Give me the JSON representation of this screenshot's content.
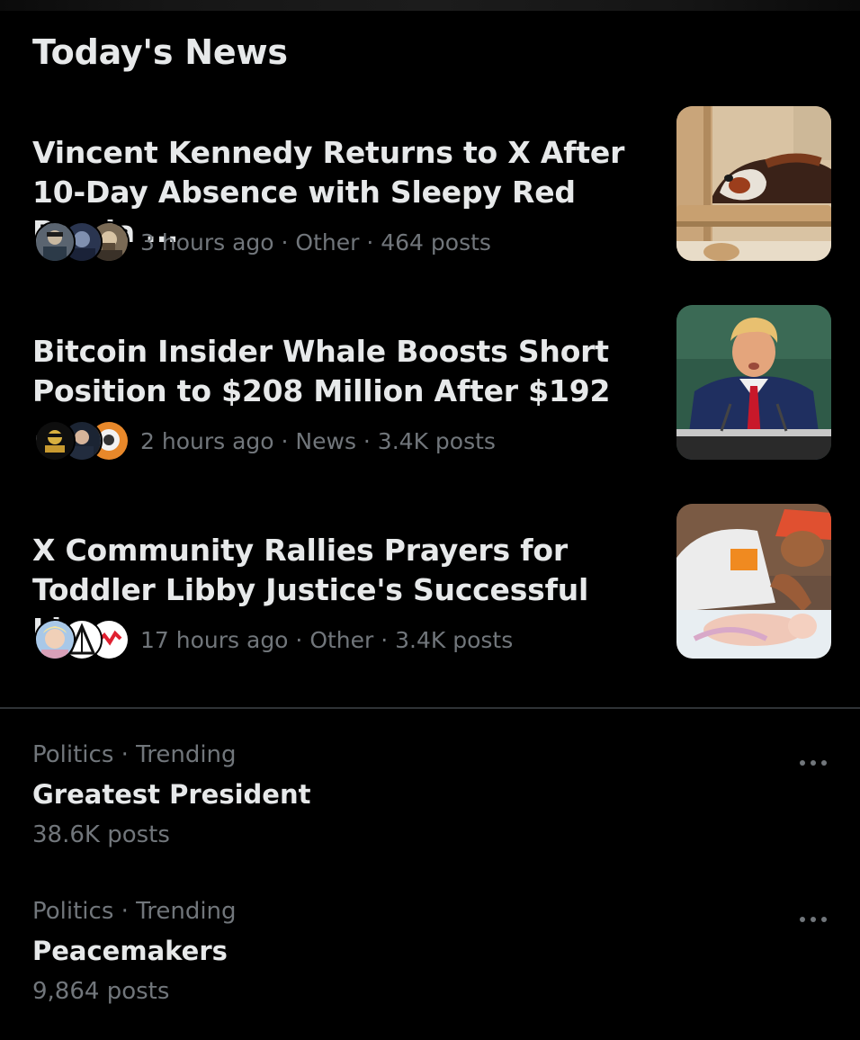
{
  "section": {
    "title": "Today's News"
  },
  "news": [
    {
      "headline": "Vincent Kennedy Returns to X After 10-Day Absence with Sleepy Red Panda ...",
      "meta": "3 hours ago · Other · 464 posts",
      "thumbnail": "red-panda-photo"
    },
    {
      "headline": "Bitcoin Insider Whale Boosts Short Position to $208 Million After $192 ...",
      "meta": "2 hours ago · News · 3.4K posts",
      "thumbnail": "speaker-at-podium-photo"
    },
    {
      "headline": "X Community Rallies Prayers for Toddler Libby Justice's Successful Liv...",
      "meta": "17 hours ago · Other · 3.4K posts",
      "thumbnail": "newborn-with-caregiver-photo"
    }
  ],
  "trends": [
    {
      "context": "Politics · Trending",
      "name": "Greatest President",
      "count": "38.6K posts"
    },
    {
      "context": "Politics · Trending",
      "name": "Peacemakers",
      "count": "9,864 posts"
    }
  ],
  "colors": {
    "background": "#000000",
    "primary_text": "#e7e9ea",
    "secondary_text": "#71767b",
    "divider": "#2f3336"
  },
  "icons": {
    "more": "more-horizontal-icon"
  }
}
